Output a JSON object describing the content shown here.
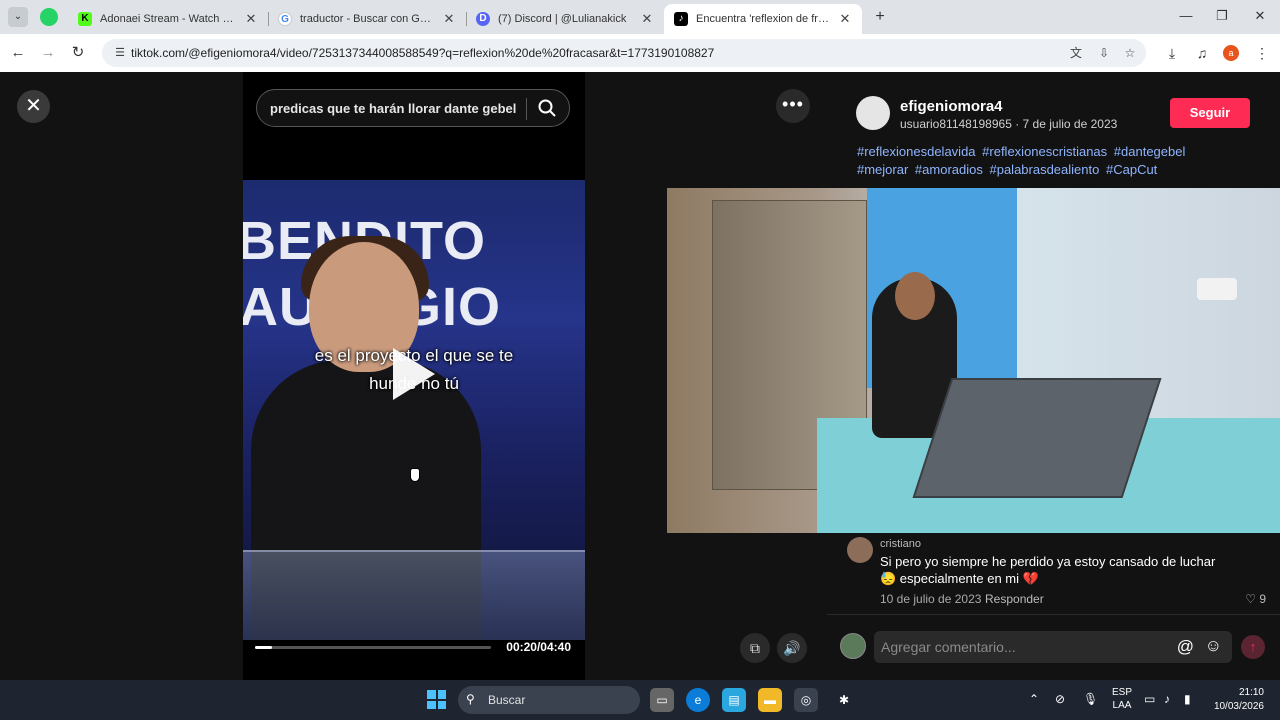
{
  "browser": {
    "tabs": [
      {
        "title": "Adonaei Stream - Watch Live o",
        "favicon_letter": "K",
        "favicon_color": "#53fc18"
      },
      {
        "title": "traductor - Buscar con Google",
        "favicon_letter": "G",
        "favicon_color": "#4285f4"
      },
      {
        "title": "(7) Discord | @Lulianakick",
        "favicon_letter": "D",
        "favicon_color": "#5865f2"
      },
      {
        "title": "Encuentra 'reflexion de fracasar",
        "favicon_letter": "♪",
        "favicon_color": "#000000"
      }
    ],
    "active_tab_index": 3,
    "url": "tiktok.com/@efigeniomora4/video/7253137344008588549?q=reflexion%20de%20fracasar&t=1773190108827",
    "profile_letter": "a"
  },
  "video": {
    "search_query": "predicas que te harán llorar dante gebel",
    "bg_text_line1": "BENDITO",
    "bg_text_line2": "AURAGIO",
    "subtitle_line1": "es el proyecto el que se te",
    "subtitle_line2": "hunde no tú",
    "time": "00:20/04:40",
    "progress_fraction": 0.071
  },
  "post": {
    "author_name": "efigeniomora4",
    "author_sub": "usuario81148198965 · 7 de julio de 2023",
    "follow_label": "Seguir",
    "hashtags": [
      "#reflexionesdelavida",
      "#reflexionescristianas",
      "#dantegebel",
      "#mejorar",
      "#amoradios",
      "#palabrasdealiento",
      "#CapCut"
    ]
  },
  "comment": {
    "user": "cristiano",
    "text_line1": "Si pero yo siempre he perdido ya estoy cansado de luchar",
    "text_line2": "😓 especialmente en mi 💔",
    "date": "10 de julio de 2023",
    "reply_label": "Responder",
    "likes": "♡ 9"
  },
  "composer": {
    "placeholder": "Agregar comentario..."
  },
  "taskbar": {
    "search_label": "Buscar",
    "lang_line1": "ESP",
    "lang_line2": "LAA",
    "time": "21:10",
    "date": "10/03/2026"
  }
}
